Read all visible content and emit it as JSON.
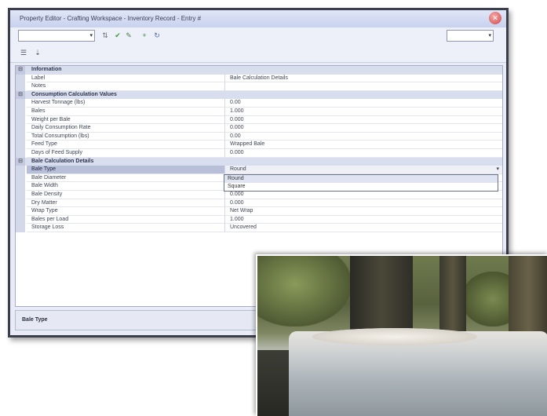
{
  "window": {
    "title": "Property Editor - Crafting Workspace - Inventory Record - Entry #",
    "close_icon": "close-icon"
  },
  "toolbar": {
    "object_combo_value": "",
    "view_combo_value": "",
    "icons": [
      "sort-icon",
      "apply-icon",
      "edit-icon",
      "add-icon",
      "refresh-icon"
    ]
  },
  "toolbar2": {
    "icons": [
      "categorized-icon",
      "alphabetical-icon"
    ]
  },
  "grid": {
    "rows": [
      {
        "type": "category",
        "name": "Information",
        "value": ""
      },
      {
        "type": "prop",
        "name": "Label",
        "value": "Bale Calculation Details"
      },
      {
        "type": "prop",
        "name": "Notes",
        "value": ""
      },
      {
        "type": "category",
        "name": "Consumption Calculation Values",
        "value": ""
      },
      {
        "type": "prop",
        "name": "Harvest Tonnage (lbs)",
        "value": "0.00"
      },
      {
        "type": "prop",
        "name": "Bales",
        "value": "1.000"
      },
      {
        "type": "prop",
        "name": "Weight per Bale",
        "value": "0.000"
      },
      {
        "type": "prop",
        "name": "Daily Consumption Rate",
        "value": "0.000"
      },
      {
        "type": "prop",
        "name": "Total Consumption (lbs)",
        "value": "0.00"
      },
      {
        "type": "prop",
        "name": "Feed Type",
        "value": "Wrapped Bale"
      },
      {
        "type": "prop",
        "name": "Days of Feed Supply",
        "value": "0.000"
      },
      {
        "type": "category",
        "name": "Bale Calculation Details",
        "value": ""
      },
      {
        "type": "selected",
        "name": "Bale Type",
        "value": "Round"
      },
      {
        "type": "prop",
        "name": "Bale Diameter",
        "value": ""
      },
      {
        "type": "prop",
        "name": "Bale Width",
        "value": ""
      },
      {
        "type": "prop",
        "name": "Bale Density",
        "value": "0.000"
      },
      {
        "type": "prop",
        "name": "Dry Matter",
        "value": "0.000"
      },
      {
        "type": "prop",
        "name": "Wrap Type",
        "value": "Net Wrap"
      },
      {
        "type": "prop",
        "name": "Bales per Load",
        "value": "1.000"
      },
      {
        "type": "prop",
        "name": "Storage Loss",
        "value": "Uncovered"
      }
    ],
    "dropdown_options": [
      "Round",
      "Square"
    ]
  },
  "status": {
    "text": "Bale Type"
  }
}
